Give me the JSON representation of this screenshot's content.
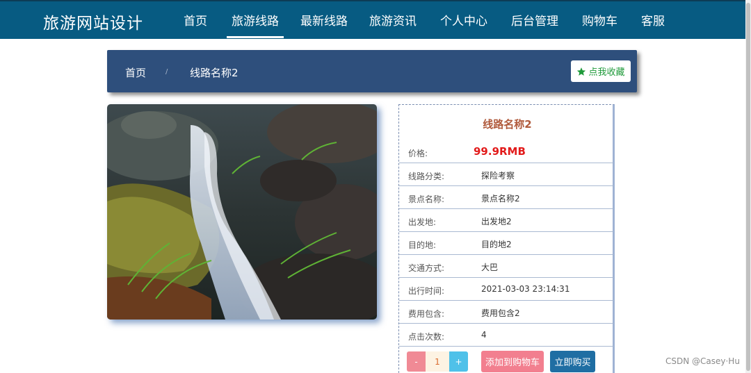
{
  "brand": "旅游网站设计",
  "nav": [
    "首页",
    "旅游线路",
    "最新线路",
    "旅游资讯",
    "个人中心",
    "后台管理",
    "购物车",
    "客服"
  ],
  "breadcrumb": {
    "home": "首页",
    "sep": "/",
    "current": "线路名称2"
  },
  "favorite_label": "点我收藏",
  "photo_icon": "waterfall-photo",
  "detail": {
    "title": "线路名称2",
    "price_label": "价格:",
    "price": "99.9RMB",
    "rows": [
      {
        "label": "线路分类:",
        "value": "探险考察"
      },
      {
        "label": "景点名称:",
        "value": "景点名称2"
      },
      {
        "label": "出发地:",
        "value": "出发地2"
      },
      {
        "label": "目的地:",
        "value": "目的地2"
      },
      {
        "label": "交通方式:",
        "value": "大巴"
      },
      {
        "label": "出行时间:",
        "value": "2021-03-03 23:14:31"
      },
      {
        "label": "费用包含:",
        "value": "费用包含2"
      },
      {
        "label": "点击次数:",
        "value": "4"
      }
    ]
  },
  "qty": {
    "minus": "-",
    "value": "1",
    "plus": "+"
  },
  "add_to_cart": "添加到购物车",
  "buy_now": "立即购买",
  "watermark": "CSDN @Casey·Hu",
  "colors": {
    "navbar": "#075b82",
    "breadcrumb_bg": "#2e4f7c",
    "price": "#e21b1b",
    "title": "#b05a3c"
  }
}
